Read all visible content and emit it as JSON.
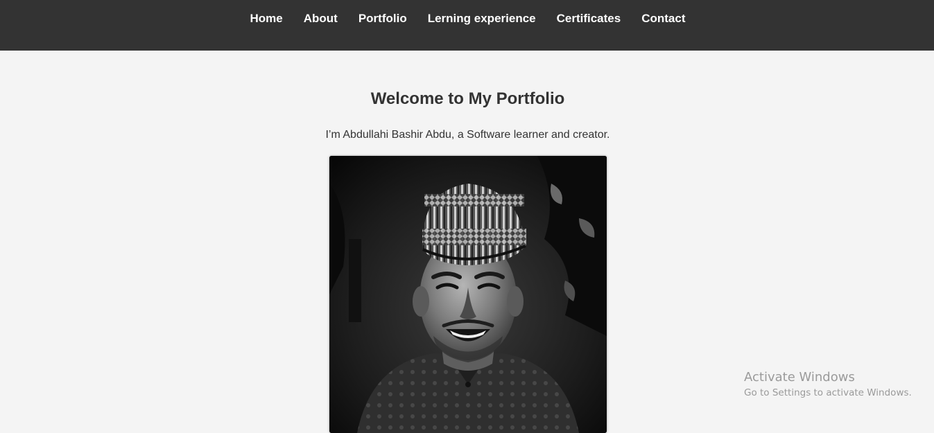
{
  "nav": {
    "items": [
      {
        "label": "Home"
      },
      {
        "label": "About"
      },
      {
        "label": "Portfolio"
      },
      {
        "label": "Lerning experience"
      },
      {
        "label": "Certificates"
      },
      {
        "label": "Contact"
      }
    ]
  },
  "hero": {
    "title": "Welcome to My Portfolio",
    "subtitle": "I’m Abdullahi Bashir Abdu, a Software learner and creator."
  },
  "photo": {
    "alt": "Black and white portrait of a smiling man wearing a patterned cap"
  },
  "watermark": {
    "title": "Activate Windows",
    "subtitle": "Go to Settings to activate Windows."
  },
  "colors": {
    "nav_bg": "#333333",
    "page_bg": "#f4f4f4",
    "text": "#333333",
    "nav_text": "#ffffff"
  }
}
